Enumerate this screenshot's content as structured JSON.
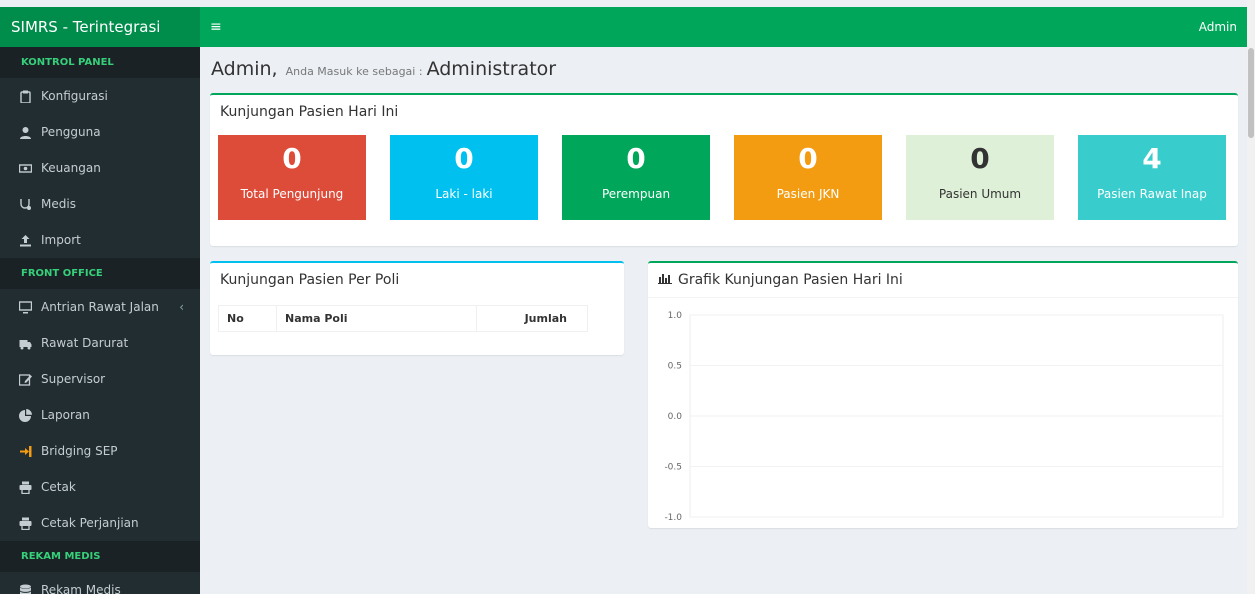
{
  "app": {
    "brand": "SIMRS - Terintegrasi",
    "menu_toggle": "≡",
    "user": "Admin"
  },
  "colors": {
    "brand_green": "#008d4c",
    "navbar_green": "#00a65a",
    "sidebar_bg": "#222d32",
    "section_header_text": "#36d07a"
  },
  "sidebar": {
    "sections": [
      {
        "header": "KONTROL PANEL",
        "items": [
          {
            "label": "Konfigurasi",
            "icon": "clipboard-icon"
          },
          {
            "label": "Pengguna",
            "icon": "user-icon"
          },
          {
            "label": "Keuangan",
            "icon": "money-icon"
          },
          {
            "label": "Medis",
            "icon": "stethoscope-icon"
          },
          {
            "label": "Import",
            "icon": "upload-icon"
          }
        ]
      },
      {
        "header": "FRONT OFFICE",
        "items": [
          {
            "label": "Antrian Rawat Jalan",
            "icon": "monitor-icon",
            "chevron": "‹"
          },
          {
            "label": "Rawat Darurat",
            "icon": "ambulance-icon"
          },
          {
            "label": "Supervisor",
            "icon": "edit-icon"
          },
          {
            "label": "Laporan",
            "icon": "pie-chart-icon"
          },
          {
            "label": "Bridging SEP",
            "icon": "sign-in-icon"
          },
          {
            "label": "Cetak",
            "icon": "print-icon"
          },
          {
            "label": "Cetak Perjanjian",
            "icon": "print-icon"
          }
        ]
      },
      {
        "header": "REKAM MEDIS",
        "items": [
          {
            "label": "Rekam Medis",
            "icon": "database-icon"
          }
        ]
      }
    ]
  },
  "header": {
    "name": "Admin,",
    "subtitle": "Anda Masuk ke sebagai :",
    "role": "Administrator"
  },
  "kunjungan_hari_ini": {
    "title": "Kunjungan Pasien Hari Ini",
    "stats": [
      {
        "value": "0",
        "label": "Total Pengunjung",
        "color": "#dd4b39"
      },
      {
        "value": "0",
        "label": "Laki - laki",
        "color": "#00c0ef"
      },
      {
        "value": "0",
        "label": "Perempuan",
        "color": "#00a65a"
      },
      {
        "value": "0",
        "label": "Pasien JKN",
        "color": "#f39c12"
      },
      {
        "value": "0",
        "label": "Pasien Umum",
        "color": "#dff0d8"
      },
      {
        "value": "4",
        "label": "Pasien Rawat Inap",
        "color": "#39cccc"
      }
    ]
  },
  "per_poli": {
    "title": "Kunjungan Pasien Per Poli",
    "columns": [
      "No",
      "Nama Poli",
      "Jumlah"
    ],
    "rows": []
  },
  "grafik": {
    "title": "Grafik Kunjungan Pasien Hari Ini",
    "chart_data": {
      "type": "line",
      "series": [],
      "y_ticks": [
        "1.0",
        "0.5",
        "0.0",
        "-0.5",
        "-1.0"
      ],
      "ylim": [
        -1.0,
        1.0
      ],
      "grid": true
    }
  }
}
